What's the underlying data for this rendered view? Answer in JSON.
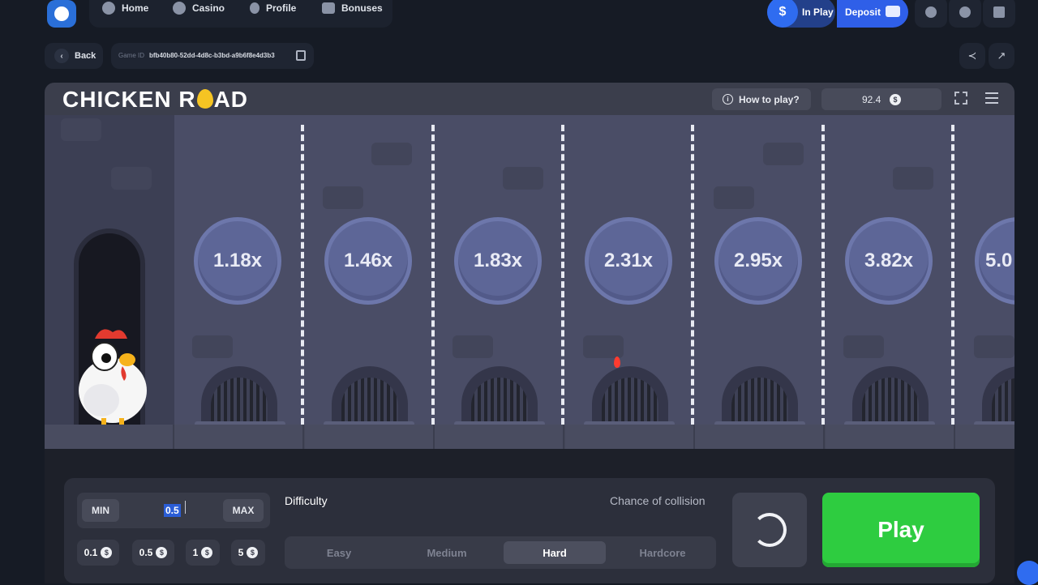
{
  "nav": {
    "items": [
      {
        "label": "Home",
        "icon": "home-icon"
      },
      {
        "label": "Casino",
        "icon": "casino-chip-icon"
      },
      {
        "label": "Profile",
        "icon": "user-icon"
      },
      {
        "label": "Bonuses",
        "icon": "gift-icon"
      }
    ],
    "in_play_label": "In Play",
    "in_play_symbol": "$",
    "deposit_label": "Deposit"
  },
  "subbar": {
    "back_label": "Back",
    "game_id_key": "Game ID",
    "game_id_value": "bfb40b80-52dd-4d8c-b3bd-a9b6f8e4d3b3"
  },
  "game": {
    "title_left": "CHICKEN R",
    "title_right": "AD",
    "how_to_play": "How to play?",
    "balance": "92.4",
    "currency_symbol": "$",
    "multipliers": [
      "1.18x",
      "1.46x",
      "1.83x",
      "2.31x",
      "2.95x",
      "3.82x",
      "5.0"
    ],
    "accent_colors": {
      "play": "#2ecc40",
      "primary": "#2f6cf0",
      "egg": "#f5c423"
    }
  },
  "controls": {
    "min_label": "MIN",
    "max_label": "MAX",
    "bet_value": "0.5",
    "quick_bets": [
      "0.1",
      "0.5",
      "1",
      "5"
    ],
    "difficulty_label": "Difficulty",
    "chance_label": "Chance of collision",
    "difficulties": [
      "Easy",
      "Medium",
      "Hard",
      "Hardcore"
    ],
    "selected_difficulty": "Hard",
    "play_label": "Play"
  }
}
